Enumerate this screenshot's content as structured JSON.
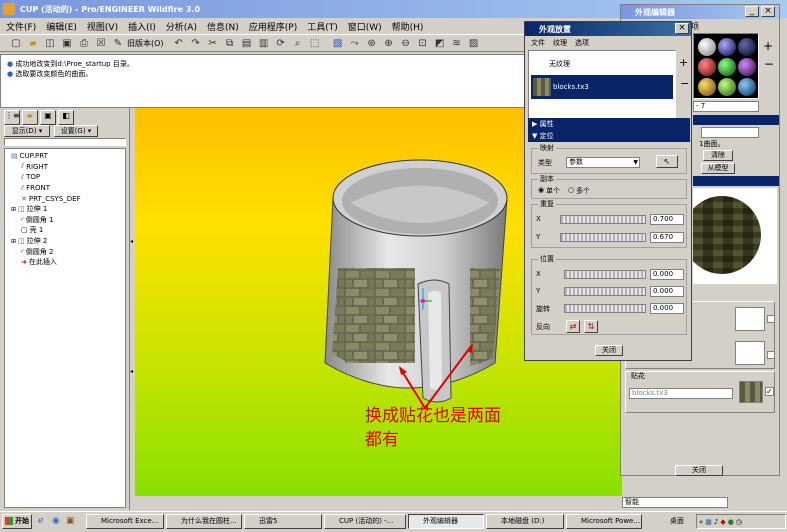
{
  "main_title": "CUP (活动的) - Pro/ENGINEER Wildfire 3.0",
  "menu": [
    "文件(F)",
    "编辑(E)",
    "视图(V)",
    "插入(I)",
    "分析(A)",
    "信息(N)",
    "应用程序(P)",
    "工具(T)",
    "窗口(W)",
    "帮助(H)"
  ],
  "toolbar_old_label": "旧版本(O)",
  "messages": [
    "成功地改变到d:\\Proe_startup 目录。",
    "选取要改变颜色的曲面。"
  ],
  "nav": {
    "show_label": "显示(D) ▾",
    "settings_label": "设置(G) ▾"
  },
  "tree": [
    "CUP.PRT",
    "RIGHT",
    "TOP",
    "FRONT",
    "PRT_CSYS_DEF",
    "拉伸 1",
    "倒圆角 1",
    "壳 1",
    "拉伸 2",
    "倒圆角 2",
    "在此插入"
  ],
  "appearance_dialog": {
    "title": "外观放置",
    "menu": [
      "文件",
      "纹理",
      "选项"
    ],
    "textures": [
      "无纹理",
      "blocks.tx3"
    ],
    "sections": {
      "properties": "属性",
      "placement": "定位"
    },
    "mapping": {
      "label": "映射",
      "type_label": "类型",
      "type_value": "参数"
    },
    "copy": {
      "label": "副本",
      "single": "单个",
      "multi": "多个"
    },
    "repeat": {
      "label": "重复",
      "x_label": "X",
      "x_value": "0.700",
      "y_label": "Y",
      "y_value": "0.670"
    },
    "position": {
      "label": "位置",
      "x_label": "X",
      "x_value": "0.000",
      "y_label": "Y",
      "y_value": "0.000",
      "rot_label": "旋转",
      "rot_value": "0.000"
    },
    "flip_label": "反向",
    "close": "关闭"
  },
  "editor": {
    "title": "外观编辑器",
    "col_label": "项",
    "count_value": "- 7",
    "btn_clear": "清除",
    "btn_from_model": "从模型",
    "surface_label": "1曲面。",
    "decal_label": "贴花",
    "decal_value": "blocks.tx3",
    "close": "关闭",
    "smart": "智能"
  },
  "annotation": {
    "line1": "换成贴花也是两面",
    "line2": "都有",
    "color": "#e00000"
  },
  "taskbar": {
    "start": "开始",
    "items": [
      "Microsoft Exce...",
      "为什么我在圆柱...",
      "迅雷5",
      "CUP (活动的) -...",
      "外观编辑器",
      "本地磁盘 (D:)",
      "Microsoft Powe..."
    ],
    "desktop": "桌面"
  }
}
